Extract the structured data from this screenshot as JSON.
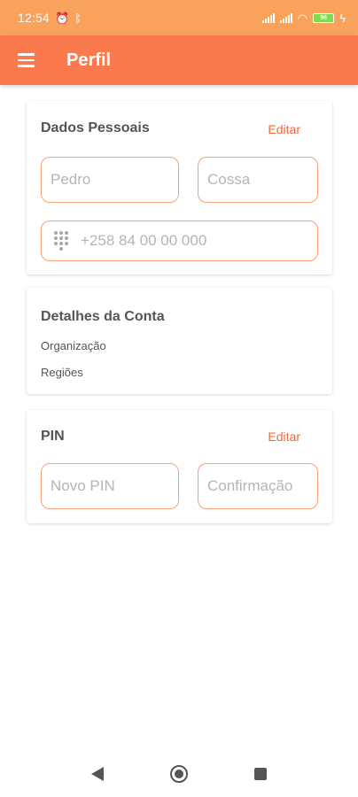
{
  "status_bar": {
    "time": "12:54",
    "battery": "96"
  },
  "app_bar": {
    "title": "Perfil"
  },
  "personal_data": {
    "title": "Dados Pessoais",
    "edit_label": "Editar",
    "first_name_placeholder": "Pedro",
    "last_name_placeholder": "Cossa",
    "phone_placeholder": "+258 84 00 00 000"
  },
  "account_details": {
    "title": "Detalhes da Conta",
    "organization_label": "Organização",
    "regions_label": "Regiões"
  },
  "pin": {
    "title": "PIN",
    "edit_label": "Editar",
    "new_pin_placeholder": "Novo PIN",
    "confirmation_placeholder": "Confirmação"
  },
  "colors": {
    "status_bar": "#f8a25c",
    "app_bar": "#fb7a4d",
    "accent": "#f0683a",
    "field_border": "#f4a17c"
  }
}
